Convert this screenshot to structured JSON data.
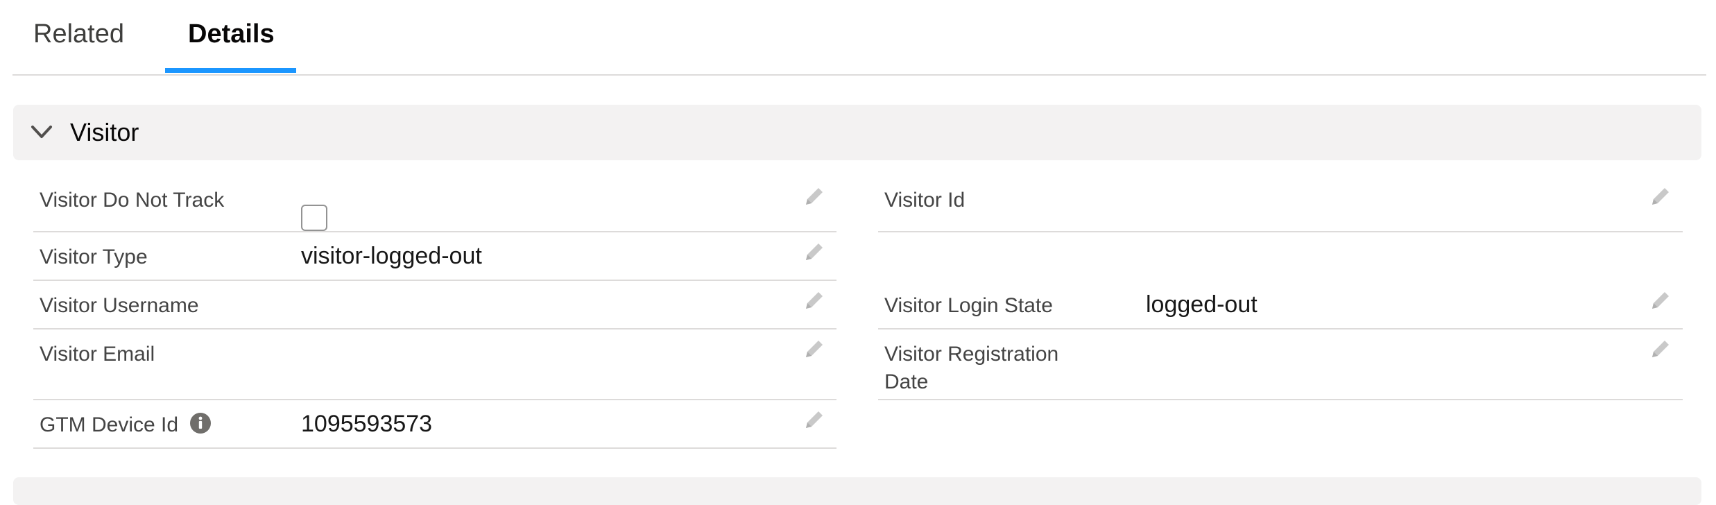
{
  "tabs": [
    {
      "label": "Related",
      "active": false
    },
    {
      "label": "Details",
      "active": true
    }
  ],
  "section": {
    "title": "Visitor",
    "expanded": true
  },
  "fields": {
    "visitor_do_not_track": {
      "label": "Visitor Do Not Track",
      "checked": false
    },
    "visitor_id": {
      "label": "Visitor Id",
      "value": ""
    },
    "visitor_type": {
      "label": "Visitor Type",
      "value": "visitor-logged-out"
    },
    "visitor_username": {
      "label": "Visitor Username",
      "value": ""
    },
    "visitor_login_state": {
      "label": "Visitor Login State",
      "value": "logged-out"
    },
    "visitor_email": {
      "label": "Visitor Email",
      "value": ""
    },
    "visitor_registration_date": {
      "label_line1": "Visitor Registration",
      "label_line2": "Date",
      "value": ""
    },
    "gtm_device_id": {
      "label": "GTM Device Id",
      "value": "1095593573"
    }
  },
  "icons": {
    "edit": "pencil-icon",
    "info": "info-icon",
    "toggle": "chevron-down-icon"
  },
  "colors": {
    "tab_active_underline": "#1b96ff",
    "section_bg": "#f3f2f2",
    "divider": "#dddbda"
  }
}
